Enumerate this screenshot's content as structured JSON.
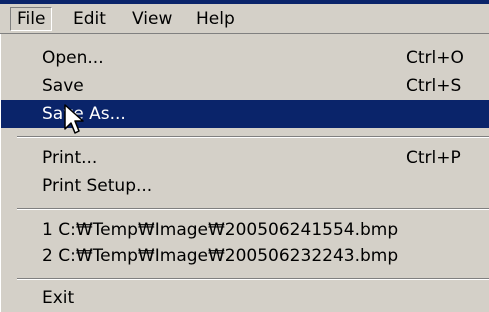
{
  "menubar": {
    "items": [
      {
        "label": "File",
        "open": true
      },
      {
        "label": "Edit"
      },
      {
        "label": "View"
      },
      {
        "label": "Help"
      }
    ]
  },
  "file_menu": {
    "open": {
      "label": "Open...",
      "shortcut": "Ctrl+O"
    },
    "save": {
      "label": "Save",
      "shortcut": "Ctrl+S"
    },
    "save_as": {
      "label": "Save As...",
      "highlighted": true
    },
    "print": {
      "label": "Print...",
      "shortcut": "Ctrl+P"
    },
    "print_setup": {
      "label": "Print Setup..."
    },
    "recent": [
      {
        "label": "1 C:₩Temp₩Image₩200506241554.bmp"
      },
      {
        "label": "2 C:₩Temp₩Image₩200506232243.bmp"
      }
    ],
    "exit": {
      "label": "Exit"
    }
  },
  "colors": {
    "menu_bg": "#d4d0c8",
    "highlight": "#0a246a",
    "highlight_text": "#ffffff"
  },
  "cursor": {
    "icon": "arrow-cursor-icon"
  }
}
